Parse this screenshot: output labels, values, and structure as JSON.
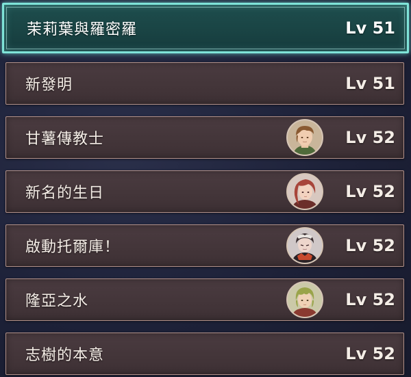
{
  "quest_list": {
    "items": [
      {
        "title": "茉莉葉與羅密羅",
        "level": "Lv 51",
        "selected": true,
        "avatar": null
      },
      {
        "title": "新發明",
        "level": "Lv 51",
        "selected": false,
        "avatar": null
      },
      {
        "title": "甘薯傳教士",
        "level": "Lv 52",
        "selected": false,
        "avatar": "brown-haired-man-portrait"
      },
      {
        "title": "新名的生日",
        "level": "Lv 52",
        "selected": false,
        "avatar": "red-haired-woman-portrait"
      },
      {
        "title": "啟動托爾庫！",
        "level": "Lv 52",
        "selected": false,
        "avatar": "dark-haired-man-portrait"
      },
      {
        "title": "隆亞之水",
        "level": "Lv 52",
        "selected": false,
        "avatar": "green-haired-youth-portrait"
      },
      {
        "title": "志樹的本意",
        "level": "Lv 52",
        "selected": false,
        "avatar": null
      }
    ]
  },
  "colors": {
    "selected_border": "#7fe3d8",
    "selected_fill": "#1a4545",
    "row_border": "#b3928a",
    "row_fill": "#433539",
    "text": "#f4ede6",
    "background": "#1d2138"
  }
}
